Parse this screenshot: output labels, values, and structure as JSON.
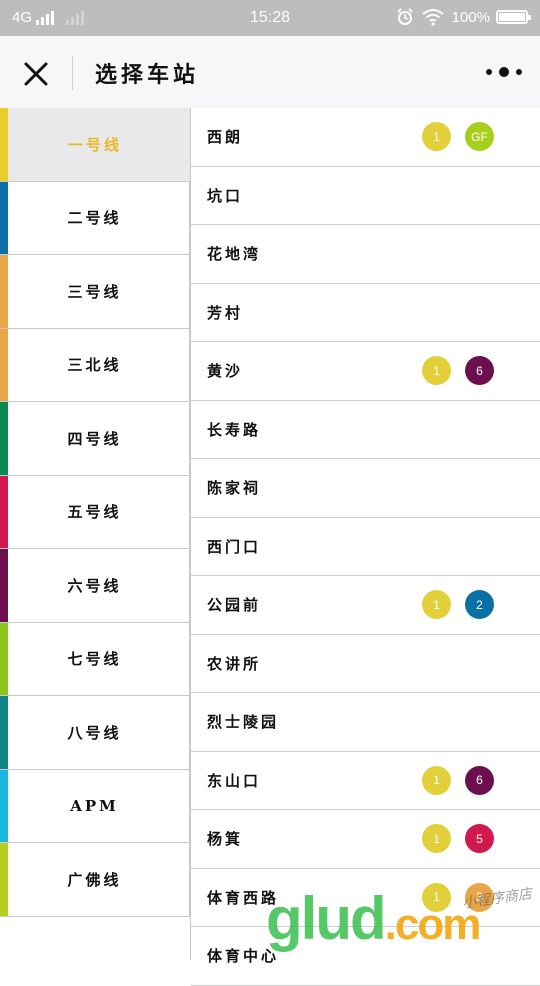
{
  "status_bar": {
    "network": "4G",
    "time": "15:28",
    "battery": "100%",
    "battery_level": 1.0
  },
  "nav": {
    "title": "选择车站"
  },
  "lines": [
    {
      "label": "一号线",
      "color": "#e8cd2d",
      "active": true
    },
    {
      "label": "二号线",
      "color": "#0a6fa6",
      "active": false
    },
    {
      "label": "三号线",
      "color": "#e8a54a",
      "active": false
    },
    {
      "label": "三北线",
      "color": "#e8a54a",
      "active": false
    },
    {
      "label": "四号线",
      "color": "#0a8a4e",
      "active": false
    },
    {
      "label": "五号线",
      "color": "#d1184f",
      "active": false
    },
    {
      "label": "六号线",
      "color": "#6d0f4f",
      "active": false
    },
    {
      "label": "七号线",
      "color": "#8bc61a",
      "active": false
    },
    {
      "label": "八号线",
      "color": "#12858a",
      "active": false
    },
    {
      "label": "APM",
      "color": "#18b8df",
      "active": false
    },
    {
      "label": "广佛线",
      "color": "#b5cf20",
      "active": false
    }
  ],
  "stations": [
    {
      "name": "西朗",
      "badges": [
        {
          "text": "1",
          "color": "#e2cf3a"
        },
        {
          "text": "GF",
          "color": "#a6cf1c"
        }
      ]
    },
    {
      "name": "坑口",
      "badges": []
    },
    {
      "name": "花地湾",
      "badges": []
    },
    {
      "name": "芳村",
      "badges": []
    },
    {
      "name": "黄沙",
      "badges": [
        {
          "text": "1",
          "color": "#e2cf3a"
        },
        {
          "text": "6",
          "color": "#6d0f4f"
        }
      ]
    },
    {
      "name": "长寿路",
      "badges": []
    },
    {
      "name": "陈家祠",
      "badges": []
    },
    {
      "name": "西门口",
      "badges": []
    },
    {
      "name": "公园前",
      "badges": [
        {
          "text": "1",
          "color": "#e2cf3a"
        },
        {
          "text": "2",
          "color": "#0a6fa6"
        }
      ]
    },
    {
      "name": "农讲所",
      "badges": []
    },
    {
      "name": "烈士陵园",
      "badges": []
    },
    {
      "name": "东山口",
      "badges": [
        {
          "text": "1",
          "color": "#e2cf3a"
        },
        {
          "text": "6",
          "color": "#6d0f4f"
        }
      ]
    },
    {
      "name": "杨箕",
      "badges": [
        {
          "text": "1",
          "color": "#e2cf3a"
        },
        {
          "text": "5",
          "color": "#d1184f"
        }
      ]
    },
    {
      "name": "体育西路",
      "badges": [
        {
          "text": "1",
          "color": "#e2cf3a"
        },
        {
          "text": "3",
          "color": "#e8a54a"
        }
      ]
    },
    {
      "name": "体育中心",
      "badges": []
    }
  ],
  "watermark": {
    "brand": "glud",
    "domain": ".com",
    "caption": "小程序商店"
  }
}
